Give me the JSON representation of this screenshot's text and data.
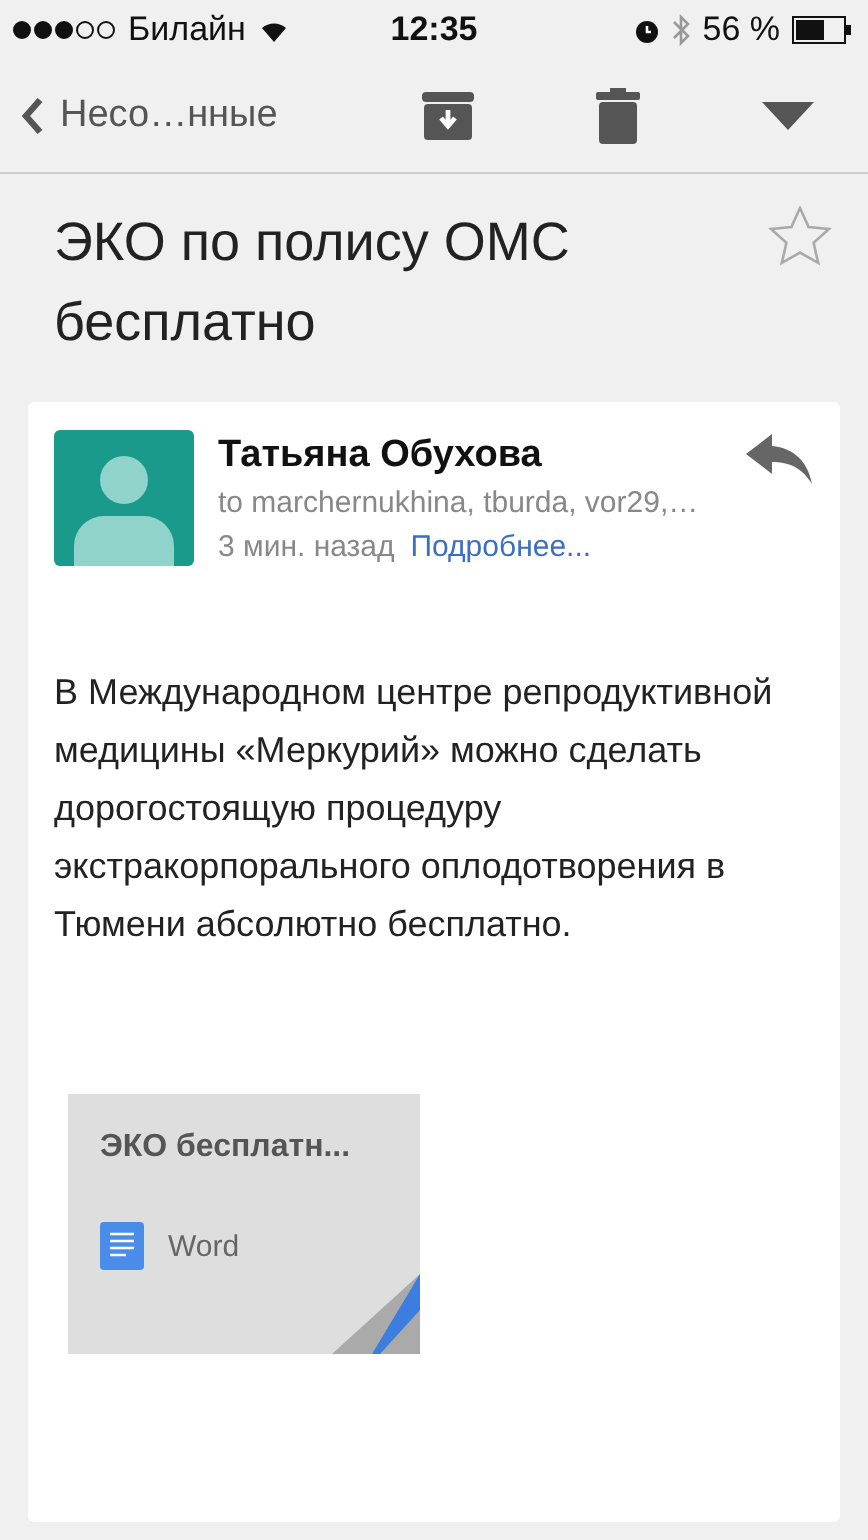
{
  "status_bar": {
    "carrier": "Билайн",
    "time": "12:35",
    "battery": "56 %"
  },
  "toolbar": {
    "back": "Несо…нные"
  },
  "message": {
    "subject": "ЭКО по полису ОМС бесплатно",
    "starred": false,
    "sender": "Татьяна Обухова",
    "recipients": "to marchernukhina, tburda, vor29,…",
    "time": "3 мин. назад",
    "details_link": "Подробнее...",
    "body": "В Международном центре репродуктивной медицины «Меркурий» можно сделать дорогостоящую процедуру экстракорпорального оплодотворения в Тюмени абсолютно бесплатно.",
    "attachment": {
      "name": "ЭКО бесплатн...",
      "type": "Word"
    }
  }
}
